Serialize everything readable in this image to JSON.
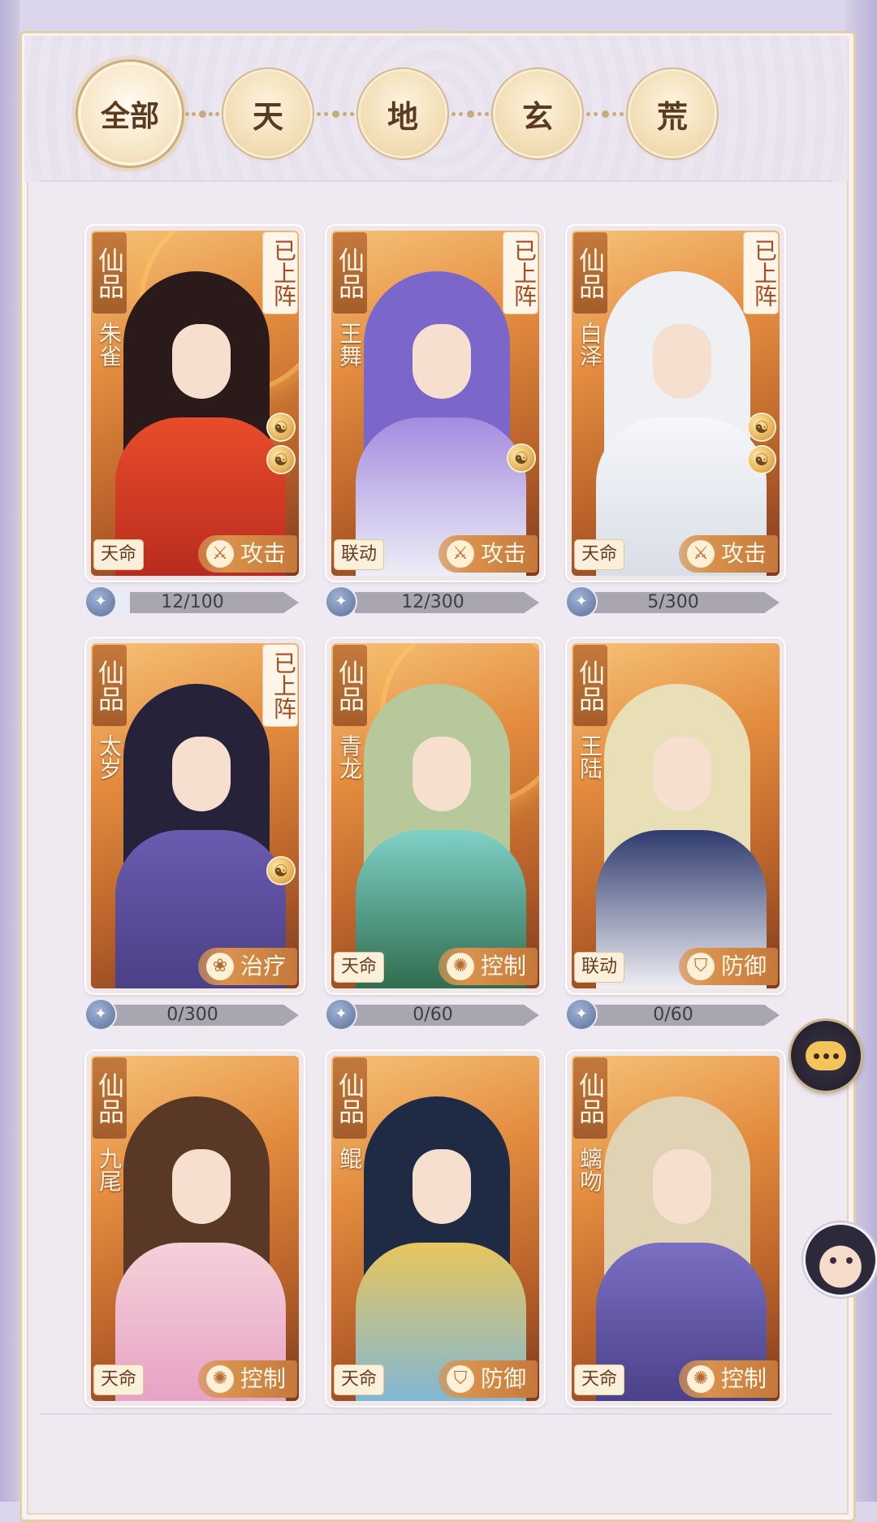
{
  "tabs": [
    {
      "label": "全部",
      "active": true
    },
    {
      "label": "天",
      "active": false
    },
    {
      "label": "地",
      "active": false
    },
    {
      "label": "玄",
      "active": false
    },
    {
      "label": "荒",
      "active": false
    }
  ],
  "cards": [
    {
      "grade": "仙品",
      "name": "朱雀",
      "deployed": "已上阵",
      "tag": "天命",
      "role": "攻击",
      "role_icon": "crossed-swords-icon",
      "yinyang_count": 2,
      "progress": "12/100",
      "progress_fraction": 0.12,
      "palette": {
        "hair": "#2a1a1a",
        "body": "#b82a1e",
        "accent": "#e84c2a"
      }
    },
    {
      "grade": "仙品",
      "name": "王舞",
      "deployed": "已上阵",
      "tag": "联动",
      "role": "攻击",
      "role_icon": "crossed-swords-icon",
      "yinyang_count": 1,
      "progress": "12/300",
      "progress_fraction": 0.04,
      "palette": {
        "hair": "#7b66c9",
        "body": "#eef0f6",
        "accent": "#a58be0"
      }
    },
    {
      "grade": "仙品",
      "name": "白泽",
      "deployed": "已上阵",
      "tag": "天命",
      "role": "攻击",
      "role_icon": "crossed-swords-icon",
      "yinyang_count": 2,
      "progress": "5/300",
      "progress_fraction": 0.02,
      "palette": {
        "hair": "#eef0f4",
        "body": "#d9dde6",
        "accent": "#f5f7fa"
      }
    },
    {
      "grade": "仙品",
      "name": "太岁",
      "deployed": "已上阵",
      "tag": "",
      "role": "治疗",
      "role_icon": "lotus-icon",
      "yinyang_count": 1,
      "progress": "0/300",
      "progress_fraction": 0,
      "palette": {
        "hair": "#26223a",
        "body": "#4b3f86",
        "accent": "#6a5bb0"
      }
    },
    {
      "grade": "仙品",
      "name": "青龙",
      "deployed": "",
      "tag": "天命",
      "role": "控制",
      "role_icon": "triskelion-icon",
      "yinyang_count": 0,
      "progress": "0/60",
      "progress_fraction": 0,
      "palette": {
        "hair": "#b7c99a",
        "body": "#2e6a4b",
        "accent": "#7fd1c7"
      }
    },
    {
      "grade": "仙品",
      "name": "王陆",
      "deployed": "",
      "tag": "联动",
      "role": "防御",
      "role_icon": "shield-icon",
      "yinyang_count": 0,
      "progress": "0/60",
      "progress_fraction": 0,
      "palette": {
        "hair": "#e9dfb6",
        "body": "#f3f3f7",
        "accent": "#2f3b6e"
      }
    },
    {
      "grade": "仙品",
      "name": "九尾",
      "deployed": "",
      "tag": "天命",
      "role": "控制",
      "role_icon": "triskelion-icon",
      "yinyang_count": 0,
      "progress": "",
      "progress_fraction": 0,
      "palette": {
        "hair": "#5a3826",
        "body": "#e7a1c4",
        "accent": "#f4d1d9"
      }
    },
    {
      "grade": "仙品",
      "name": "鲲",
      "deployed": "",
      "tag": "天命",
      "role": "防御",
      "role_icon": "shield-icon",
      "yinyang_count": 0,
      "progress": "",
      "progress_fraction": 0,
      "palette": {
        "hair": "#1f2b45",
        "body": "#7fb7d8",
        "accent": "#e8c65c"
      }
    },
    {
      "grade": "仙品",
      "name": "螭吻",
      "deployed": "",
      "tag": "天命",
      "role": "控制",
      "role_icon": "triskelion-icon",
      "yinyang_count": 0,
      "progress": "",
      "progress_fraction": 0,
      "palette": {
        "hair": "#e0d3b3",
        "body": "#4a3f88",
        "accent": "#7b6fc2"
      }
    }
  ],
  "colors": {
    "grade_bg": "#b06a32",
    "tab_text": "#5b3a22",
    "panel_bg": "#efeaf2"
  }
}
